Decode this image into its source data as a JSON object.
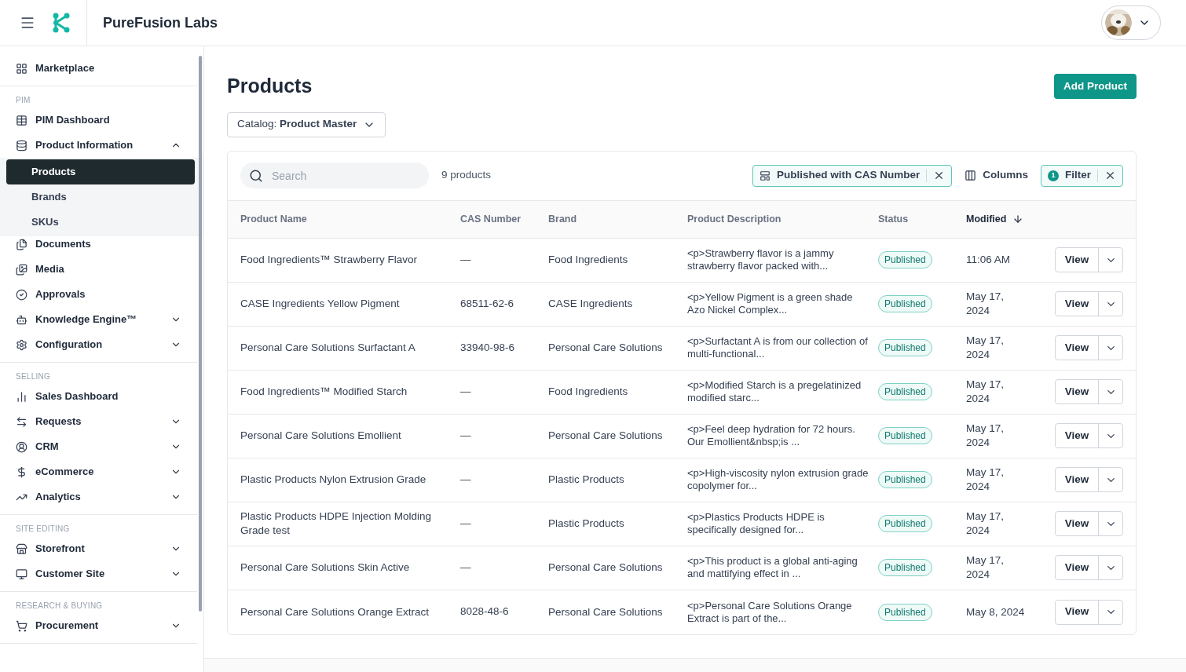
{
  "header": {
    "company": "PureFusion Labs"
  },
  "sidebar": {
    "sections": [
      {
        "items": [
          {
            "label": "Marketplace"
          }
        ]
      },
      {
        "title": "PIM",
        "items": [
          {
            "label": "PIM Dashboard"
          },
          {
            "label": "Product Information",
            "expanded": true,
            "children": [
              {
                "label": "Products",
                "selected": true
              },
              {
                "label": "Brands",
                "selected": false
              },
              {
                "label": "SKUs",
                "selected": false
              }
            ]
          },
          {
            "label": "Documents"
          },
          {
            "label": "Media"
          },
          {
            "label": "Approvals"
          },
          {
            "label": "Knowledge Engine™",
            "expanded": false
          },
          {
            "label": "Configuration",
            "expanded": false
          }
        ]
      },
      {
        "title": "SELLING",
        "items": [
          {
            "label": "Sales Dashboard"
          },
          {
            "label": "Requests",
            "expanded": false
          },
          {
            "label": "CRM",
            "expanded": false
          },
          {
            "label": "eCommerce",
            "expanded": false
          },
          {
            "label": "Analytics",
            "expanded": false
          }
        ]
      },
      {
        "title": "SITE EDITING",
        "items": [
          {
            "label": "Storefront",
            "expanded": false
          },
          {
            "label": "Customer Site",
            "expanded": false
          }
        ]
      },
      {
        "title": "RESEARCH & BUYING",
        "items": [
          {
            "label": "Procurement",
            "expanded": false
          }
        ]
      }
    ]
  },
  "page": {
    "title": "Products",
    "add_button": "Add Product",
    "catalog": "Catalog: **Product Master**"
  },
  "toolbar": {
    "search_placeholder": "Search",
    "count": "9 products",
    "saved_view": "Published with CAS Number",
    "columns_button": "Columns",
    "filter_count": "1",
    "filter_button": "Filter"
  },
  "table": {
    "columns": [
      {
        "label": "Product Name",
        "sorted": false
      },
      {
        "label": "CAS Number",
        "sorted": false
      },
      {
        "label": "Brand",
        "sorted": false
      },
      {
        "label": "Product Description",
        "sorted": false
      },
      {
        "label": "Status",
        "sorted": false
      },
      {
        "label": "Modified",
        "sorted": true
      }
    ],
    "rows": [
      {
        "name": "Food Ingredients™ Strawberry Flavor",
        "cas": "—",
        "brand": "Food Ingredients",
        "description": "<p>Strawberry flavor is a jammy strawberry flavor packed with...",
        "status": "Published",
        "modified": "11:06 AM",
        "action": "View"
      },
      {
        "name": "CASE Ingredients Yellow Pigment",
        "cas": "68511-62-6",
        "brand": "CASE Ingredients",
        "description": "<p>Yellow Pigment is a green shade Azo Nickel Complex...",
        "status": "Published",
        "modified": "May 17, 2024",
        "action": "View"
      },
      {
        "name": "Personal Care Solutions Surfactant A",
        "cas": "33940-98-6",
        "brand": "Personal Care Solutions",
        "description": "<p>Surfactant A is from our collection of multi-functional...",
        "status": "Published",
        "modified": "May 17, 2024",
        "action": "View"
      },
      {
        "name": "Food Ingredients™ Modified Starch",
        "cas": "—",
        "brand": "Food Ingredients",
        "description": "<p>Modified Starch is a pregelatinized modified starc...",
        "status": "Published",
        "modified": "May 17, 2024",
        "action": "View"
      },
      {
        "name": "Personal Care Solutions Emollient",
        "cas": "—",
        "brand": "Personal Care Solutions",
        "description": "<p>Feel deep hydration for 72 hours. Our Emollient&nbsp;is ...",
        "status": "Published",
        "modified": "May 17, 2024",
        "action": "View"
      },
      {
        "name": "Plastic Products Nylon Extrusion Grade",
        "cas": "—",
        "brand": "Plastic Products",
        "description": "<p>High-viscosity nylon extrusion grade copolymer for...",
        "status": "Published",
        "modified": "May 17, 2024",
        "action": "View"
      },
      {
        "name": "Plastic Products HDPE Injection Molding Grade test",
        "cas": "—",
        "brand": "Plastic Products",
        "description": "<p>Plastics Products HDPE is specifically designed for...",
        "status": "Published",
        "modified": "May 17, 2024",
        "action": "View"
      },
      {
        "name": "Personal Care Solutions Skin Active",
        "cas": "—",
        "brand": "Personal Care Solutions",
        "description": "<p>This product is a global anti-aging and mattifying effect in ...",
        "status": "Published",
        "modified": "May 17, 2024",
        "action": "View"
      },
      {
        "name": "Personal Care Solutions Orange Extract",
        "cas": "8028-48-6",
        "brand": "Personal Care Solutions",
        "description": "<p>Personal Care Solutions Orange Extract is part of the...",
        "status": "Published",
        "modified": "May 8, 2024",
        "action": "View"
      }
    ]
  }
}
